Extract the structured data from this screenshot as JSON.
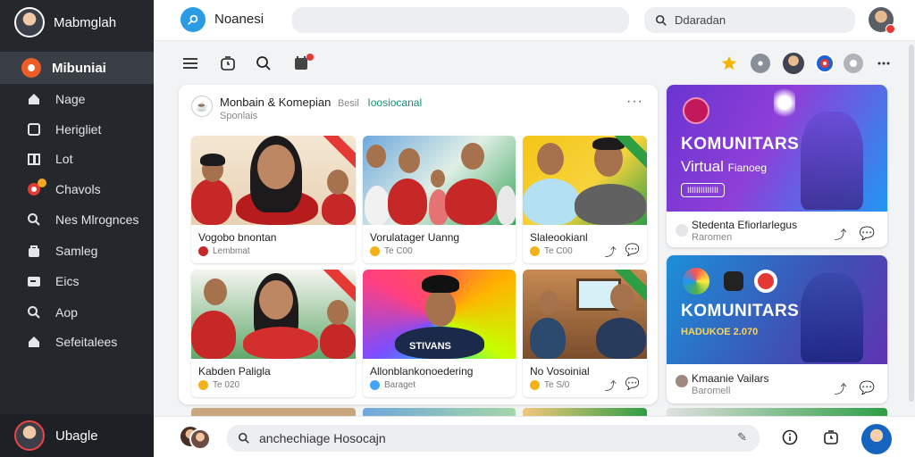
{
  "sidebar": {
    "profile_name": "Mabmglah",
    "active_label": "Mibuniai",
    "items": [
      {
        "label": "Nage",
        "icon": "home-icon"
      },
      {
        "label": "Herigliet",
        "icon": "calendar-icon"
      },
      {
        "label": "Lot",
        "icon": "book-icon"
      },
      {
        "label": "Chavols",
        "icon": "badge-icon"
      },
      {
        "label": "Nes Mlrognces",
        "icon": "search-icon"
      },
      {
        "label": "Samleg",
        "icon": "bag-icon"
      },
      {
        "label": "Eics",
        "icon": "folder-icon"
      },
      {
        "label": "Aop",
        "icon": "search-icon"
      },
      {
        "label": "Sefeitalees",
        "icon": "home-icon"
      }
    ],
    "bottom_name": "Ubagle"
  },
  "topbar": {
    "brand_name": "Noanesi",
    "search2_placeholder": "Ddaradan"
  },
  "feed": {
    "title": "Monbain & Komepian",
    "title_tag": "Besil",
    "title_link": "Ioosiocanal",
    "subtitle": "Sponlais",
    "more": "···",
    "tiles": [
      {
        "title": "Vogobo bnontan",
        "meta": "Lembmat"
      },
      {
        "title": "Vorulatager Uanng",
        "meta": "Te C00"
      },
      {
        "title": "Slaleookianl",
        "meta": "Te C00"
      },
      {
        "title": "Kabden Paligla",
        "meta": "Te 020"
      },
      {
        "title": "Allonblankonoedering",
        "meta": "Baraget"
      },
      {
        "title": "No Vosoinial",
        "meta": "Te S/0"
      }
    ],
    "shirt_text": "STIVANS"
  },
  "promos": [
    {
      "title": "KOMUNITARS",
      "subtitle": "Virtual",
      "subtitle_small": "Fianoeg",
      "button": "IIIIIIIIIIIIII",
      "foot_title": "Stedenta Efiorlarlegus",
      "foot_meta": "Raromen"
    },
    {
      "title": "KOMUNITARS",
      "subtitle": "HADUKOE 2.070",
      "foot_title": "Kmaanie Vailars",
      "foot_meta": "Baromell"
    }
  ],
  "bottombar": {
    "input_text": "anchechiage Hosocajn"
  },
  "colors": {
    "sidebar_bg": "#24272c",
    "accent_blue": "#2b9be6",
    "promo1_start": "#7b3fd6",
    "promo2_start": "#1c8fd8"
  }
}
